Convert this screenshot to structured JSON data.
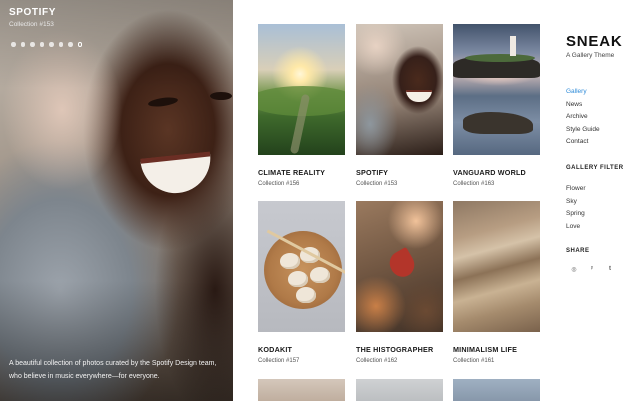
{
  "hero": {
    "title": "SPOTIFY",
    "subtitle": "Collection #153",
    "slide_count": 8,
    "active_slide": 8,
    "description": "A beautiful collection of photos curated by the Spotify Design team, who believe in music everywhere—for everyone."
  },
  "cards": [
    {
      "title": "CLIMATE REALITY",
      "subtitle": "Collection #156"
    },
    {
      "title": "SPOTIFY",
      "subtitle": "Collection #153"
    },
    {
      "title": "VANGUARD WORLD",
      "subtitle": "Collection #163"
    },
    {
      "title": "KODAKIT",
      "subtitle": "Collection #157"
    },
    {
      "title": "THE HISTOGRAPHER",
      "subtitle": "Collection #162"
    },
    {
      "title": "MINIMALISM LIFE",
      "subtitle": "Collection #161"
    }
  ],
  "sidebar": {
    "brand": "SNEAK",
    "tagline": "A Gallery Theme",
    "nav": [
      "Gallery",
      "News",
      "Archive",
      "Style Guide",
      "Contact"
    ],
    "active_nav": "Gallery",
    "filter_heading": "GALLERY FILTER",
    "filters": [
      "Flower",
      "Sky",
      "Spring",
      "Love"
    ],
    "share_heading": "SHARE",
    "share_icons": [
      "instagram-icon",
      "pinterest-icon",
      "tumblr-icon"
    ]
  },
  "colors": {
    "accent": "#2f8bd8",
    "text": "#1a1a1a"
  }
}
